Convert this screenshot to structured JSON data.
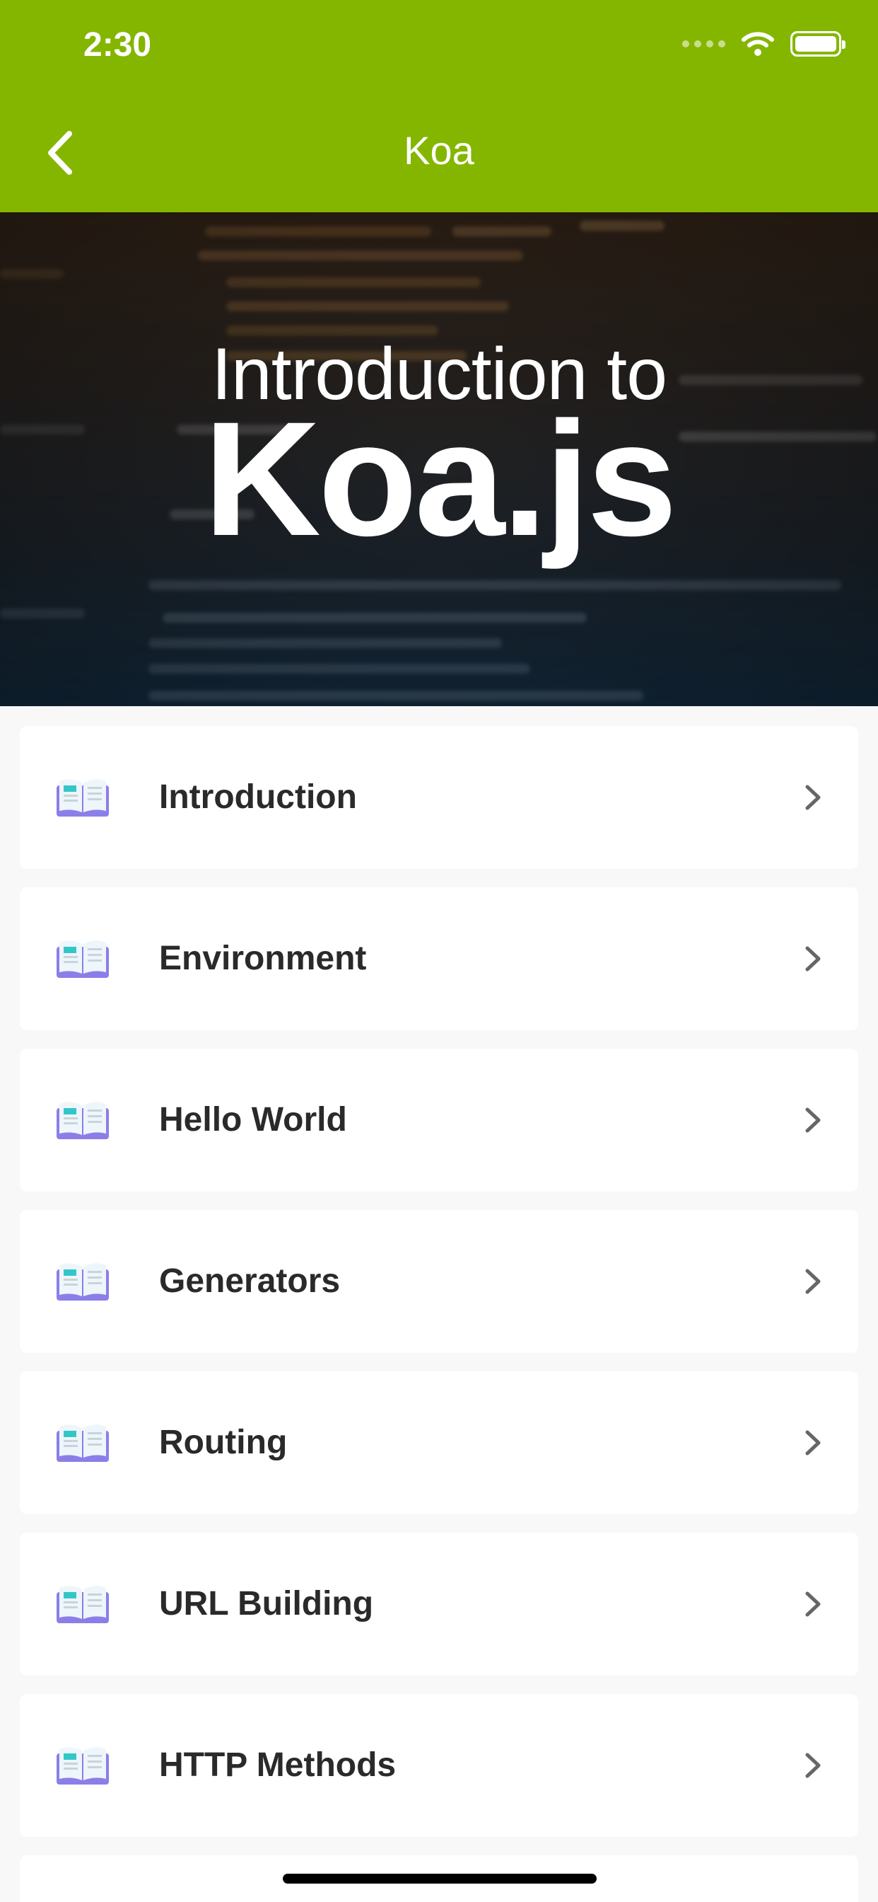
{
  "status_bar": {
    "time": "2:30"
  },
  "appbar": {
    "title": "Koa",
    "back_icon": "chevron-left-icon",
    "color": "#84b600"
  },
  "banner": {
    "subtitle": "Introduction to",
    "title": "Koa.js"
  },
  "lessons": [
    {
      "label": "Introduction"
    },
    {
      "label": "Environment"
    },
    {
      "label": "Hello World"
    },
    {
      "label": "Generators"
    },
    {
      "label": "Routing"
    },
    {
      "label": "URL Building"
    },
    {
      "label": "HTTP Methods"
    }
  ],
  "icons": {
    "lesson_icon": "book-icon",
    "row_icon": "chevron-right-icon"
  }
}
